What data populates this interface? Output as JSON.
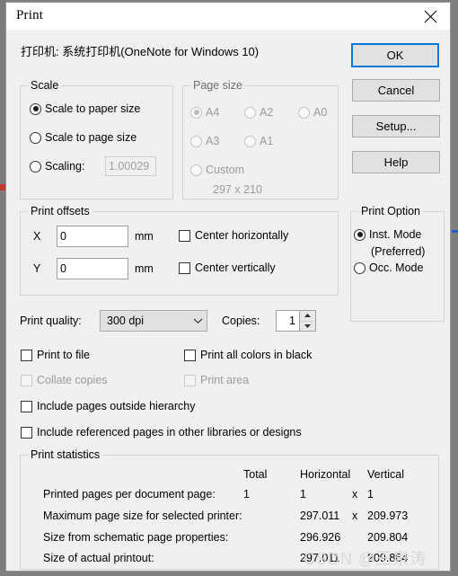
{
  "window": {
    "title": "Print",
    "close_icon": "close-icon",
    "printer_line": "打印机: 系统打印机(OneNote for Windows 10)"
  },
  "buttons": {
    "ok": "OK",
    "cancel": "Cancel",
    "setup": "Setup...",
    "help": "Help"
  },
  "scale": {
    "legend": "Scale",
    "options": [
      {
        "label": "Scale to paper size",
        "selected": true
      },
      {
        "label": "Scale to page size",
        "selected": false
      },
      {
        "label": "Scaling:",
        "selected": false
      }
    ],
    "scaling_value": "1.00029"
  },
  "page_size": {
    "legend": "Page size",
    "disabled": true,
    "options": [
      {
        "label": "A4",
        "selected": true
      },
      {
        "label": "A2",
        "selected": false
      },
      {
        "label": "A0",
        "selected": false
      },
      {
        "label": "A3",
        "selected": false
      },
      {
        "label": "A1",
        "selected": false
      },
      {
        "label": "Custom",
        "selected": false
      }
    ],
    "dimensions": "297 x 210"
  },
  "print_offsets": {
    "legend": "Print offsets",
    "x_label": "X",
    "x_value": "0",
    "x_unit": "mm",
    "y_label": "Y",
    "y_value": "0",
    "y_unit": "mm",
    "center_horizontally": {
      "label": "Center horizontally",
      "checked": false
    },
    "center_vertically": {
      "label": "Center vertically",
      "checked": false
    }
  },
  "print_option": {
    "legend": "Print Option",
    "options": [
      {
        "label": "Inst. Mode",
        "label2": "(Preferred)",
        "selected": true
      },
      {
        "label": "Occ. Mode",
        "label2": "",
        "selected": false
      }
    ]
  },
  "quality": {
    "label": "Print quality:",
    "value": "300 dpi",
    "chevron_icon": "chevron-down-icon",
    "copies_label": "Copies:",
    "copies_value": "1",
    "spin_up_icon": "spin-up-icon",
    "spin_down_icon": "spin-down-icon"
  },
  "checkboxes": [
    {
      "label": "Print to file",
      "checked": false,
      "disabled": false
    },
    {
      "label": "Print all colors in black",
      "checked": false,
      "disabled": false
    },
    {
      "label": "Collate copies",
      "checked": false,
      "disabled": true
    },
    {
      "label": "Print area",
      "checked": false,
      "disabled": true
    },
    {
      "label": "Include pages outside hierarchy",
      "checked": false,
      "disabled": false
    },
    {
      "label": "Include referenced pages in other libraries or designs",
      "checked": false,
      "disabled": false
    }
  ],
  "statistics": {
    "legend": "Print statistics",
    "headers": {
      "total": "Total",
      "horizontal": "Horizontal",
      "vertical": "Vertical"
    },
    "rows": [
      {
        "label": "Printed pages per document page:",
        "total": "1",
        "horizontal": "1",
        "sep": "x",
        "vertical": "1"
      },
      {
        "label": "Maximum page size for selected printer:",
        "total": "",
        "horizontal": "297.011",
        "sep": "x",
        "vertical": "209.973"
      },
      {
        "label": "Size from schematic page properties:",
        "total": "",
        "horizontal": "296.926",
        "sep": "",
        "vertical": "209.804"
      },
      {
        "label": "Size of actual printout:",
        "total": "",
        "horizontal": "297.011",
        "sep": "",
        "vertical": "209.864"
      }
    ]
  },
  "watermark": "CSDN @王泉涛",
  "colors": {
    "accent": "#0078d7",
    "window_bg": "#f0f0f0",
    "titlebar_bg": "#ffffff",
    "button_bg": "#e1e1e1",
    "disabled_text": "#9b9b9b"
  }
}
